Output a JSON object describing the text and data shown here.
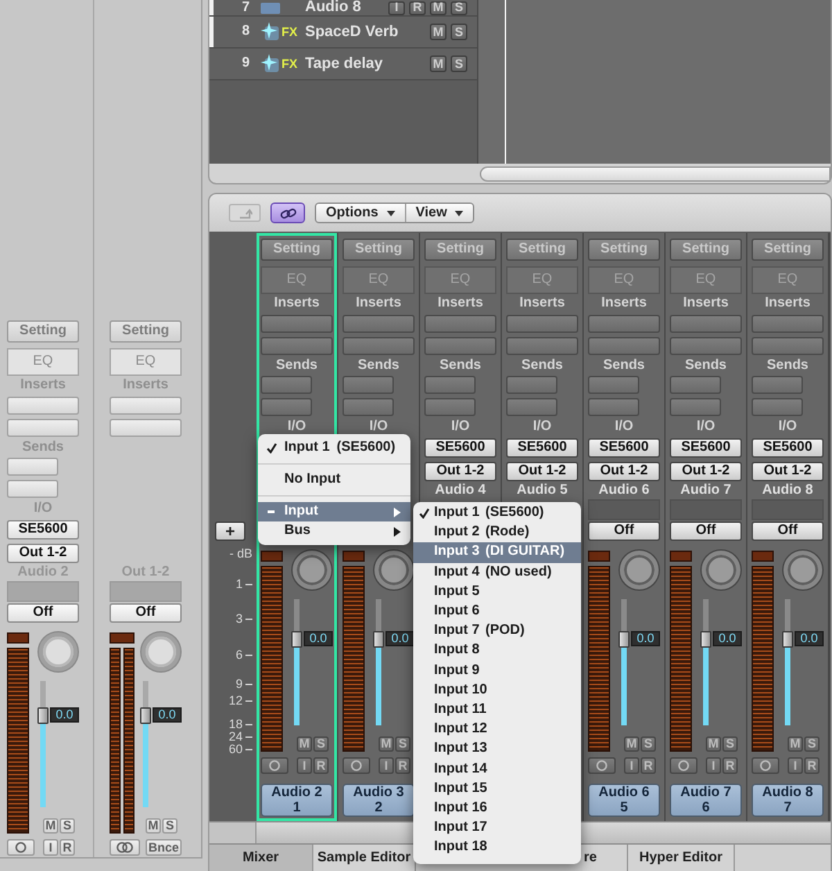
{
  "track_list": {
    "rows": [
      {
        "number": "7",
        "name": "Audio 8",
        "kind": "audio",
        "marked": true,
        "buttons": [
          "I",
          "R",
          "M",
          "S"
        ]
      },
      {
        "number": "8",
        "name": "SpaceD Verb",
        "kind": "aux",
        "icon_label": "FX",
        "marked": true,
        "buttons": [
          "M",
          "S"
        ]
      },
      {
        "number": "9",
        "name": "Tape delay",
        "kind": "aux",
        "icon_label": "FX",
        "marked": false,
        "buttons": [
          "M",
          "S"
        ]
      }
    ]
  },
  "inspector": {
    "strips": [
      {
        "setting": "Setting",
        "eq": "EQ",
        "inserts_label": "Inserts",
        "sends_label": "Sends",
        "io_label": "I/O",
        "input": "SE5600",
        "output": "Out 1-2",
        "name": "Audio 2",
        "automation": "Off",
        "kind": "mono",
        "fader": {
          "level": 0.72,
          "value": "0.0"
        },
        "mute": "M",
        "solo": "S",
        "input_monitor": "I",
        "record": "R"
      },
      {
        "setting": "Setting",
        "eq": "EQ",
        "inserts_label": "Inserts",
        "name": "Out 1-2",
        "automation": "Off",
        "kind": "stereo",
        "fader": {
          "level": 0.72,
          "value": "0.0"
        },
        "mute": "M",
        "solo": "S",
        "bounce": "Bnce"
      }
    ]
  },
  "toolbar": {
    "back_disabled": true,
    "link_on": true,
    "menus": [
      {
        "label": "Options"
      },
      {
        "label": "View"
      }
    ]
  },
  "mixer": {
    "add_button": "+",
    "scale": [
      "- dB",
      "1",
      "3",
      "6",
      "9",
      "12",
      "18",
      "24",
      "60"
    ],
    "strips": [
      {
        "selected": true,
        "setting": "Setting",
        "eq": "EQ",
        "inserts_label": "Inserts",
        "sends_label": "Sends",
        "io_label": "I/O",
        "kind": "mono",
        "fader": {
          "level": 0.68,
          "value": "0.0"
        },
        "mute": "M",
        "solo": "S",
        "input_monitor": "I",
        "record": "R",
        "track_name": "Audio 2",
        "track_number": "1"
      },
      {
        "selected": false,
        "setting": "Setting",
        "eq": "EQ",
        "inserts_label": "Inserts",
        "sends_label": "Sends",
        "io_label": "I/O",
        "kind": "mono",
        "fader": {
          "level": 0.68,
          "value": "0.0"
        },
        "mute": "M",
        "solo": "S",
        "input_monitor": "I",
        "record": "R",
        "track_name": "Audio 3",
        "track_number": "2"
      },
      {
        "selected": false,
        "setting": "Setting",
        "eq": "EQ",
        "inserts_label": "Inserts",
        "sends_label": "Sends",
        "io_label": "I/O",
        "input": "SE5600",
        "output": "Out 1-2",
        "name": "Audio 4"
      },
      {
        "selected": false,
        "setting": "Setting",
        "eq": "EQ",
        "inserts_label": "Inserts",
        "sends_label": "Sends",
        "io_label": "I/O",
        "input": "SE5600",
        "output": "Out 1-2",
        "name": "Audio 5"
      },
      {
        "selected": false,
        "setting": "Setting",
        "eq": "EQ",
        "inserts_label": "Inserts",
        "sends_label": "Sends",
        "io_label": "I/O",
        "input": "SE5600",
        "output": "Out 1-2",
        "name": "Audio 6",
        "automation": "Off",
        "kind": "mono",
        "fader": {
          "level": 0.68,
          "value": "0.0"
        },
        "mute": "M",
        "solo": "S",
        "input_monitor": "I",
        "record": "R",
        "track_name": "Audio 6",
        "track_number": "5"
      },
      {
        "selected": false,
        "setting": "Setting",
        "eq": "EQ",
        "inserts_label": "Inserts",
        "sends_label": "Sends",
        "io_label": "I/O",
        "input": "SE5600",
        "output": "Out 1-2",
        "name": "Audio 7",
        "automation": "Off",
        "kind": "mono",
        "fader": {
          "level": 0.68,
          "value": "0.0"
        },
        "mute": "M",
        "solo": "S",
        "input_monitor": "I",
        "record": "R",
        "track_name": "Audio 7",
        "track_number": "6"
      },
      {
        "selected": false,
        "setting": "Setting",
        "eq": "EQ",
        "inserts_label": "Inserts",
        "sends_label": "Sends",
        "io_label": "I/O",
        "input": "SE5600",
        "output": "Out 1-2",
        "name": "Audio 8",
        "automation": "Off",
        "kind": "mono",
        "fader": {
          "level": 0.68,
          "value": "0.0"
        },
        "mute": "M",
        "solo": "S",
        "input_monitor": "I",
        "record": "R",
        "track_name": "Audio 8",
        "track_number": "7"
      }
    ]
  },
  "popup_menu": {
    "items": [
      {
        "label": "Input 1",
        "note": "(SE5600)",
        "checked": true,
        "mixed": false,
        "selected": false,
        "submenu": false,
        "separator_after": true
      },
      {
        "label": "No Input",
        "checked": false,
        "mixed": false,
        "selected": false,
        "submenu": false,
        "separator_after": true
      },
      {
        "label": "Input",
        "checked": false,
        "mixed": true,
        "selected": true,
        "submenu": true,
        "separator_after": false
      },
      {
        "label": "Bus",
        "checked": false,
        "mixed": false,
        "selected": false,
        "submenu": true,
        "separator_after": false
      }
    ]
  },
  "submenu": {
    "items": [
      {
        "label": "Input 1",
        "note": "(SE5600)",
        "checked": true,
        "selected": false
      },
      {
        "label": "Input 2",
        "note": "(Rode)",
        "checked": false,
        "selected": false
      },
      {
        "label": "Input 3",
        "note": "(DI GUITAR)",
        "checked": false,
        "selected": true
      },
      {
        "label": "Input 4",
        "note": "(NO used)",
        "checked": false,
        "selected": false
      },
      {
        "label": "Input 5",
        "checked": false,
        "selected": false
      },
      {
        "label": "Input 6",
        "checked": false,
        "selected": false
      },
      {
        "label": "Input 7",
        "note": "(POD)",
        "checked": false,
        "selected": false
      },
      {
        "label": "Input 8",
        "checked": false,
        "selected": false
      },
      {
        "label": "Input 9",
        "checked": false,
        "selected": false
      },
      {
        "label": "Input 10",
        "checked": false,
        "selected": false
      },
      {
        "label": "Input 11",
        "checked": false,
        "selected": false
      },
      {
        "label": "Input 12",
        "checked": false,
        "selected": false
      },
      {
        "label": "Input 13",
        "checked": false,
        "selected": false
      },
      {
        "label": "Input 14",
        "checked": false,
        "selected": false
      },
      {
        "label": "Input 15",
        "checked": false,
        "selected": false
      },
      {
        "label": "Input 16",
        "checked": false,
        "selected": false
      },
      {
        "label": "Input 17",
        "checked": false,
        "selected": false
      },
      {
        "label": "Input 18",
        "checked": false,
        "selected": false
      }
    ]
  },
  "tabs": [
    {
      "label": "Mixer",
      "selected": true
    },
    {
      "label": "Sample Editor",
      "selected": false
    },
    {
      "label": "re",
      "selected": false
    },
    {
      "label": "Hyper Editor",
      "selected": false
    }
  ]
}
